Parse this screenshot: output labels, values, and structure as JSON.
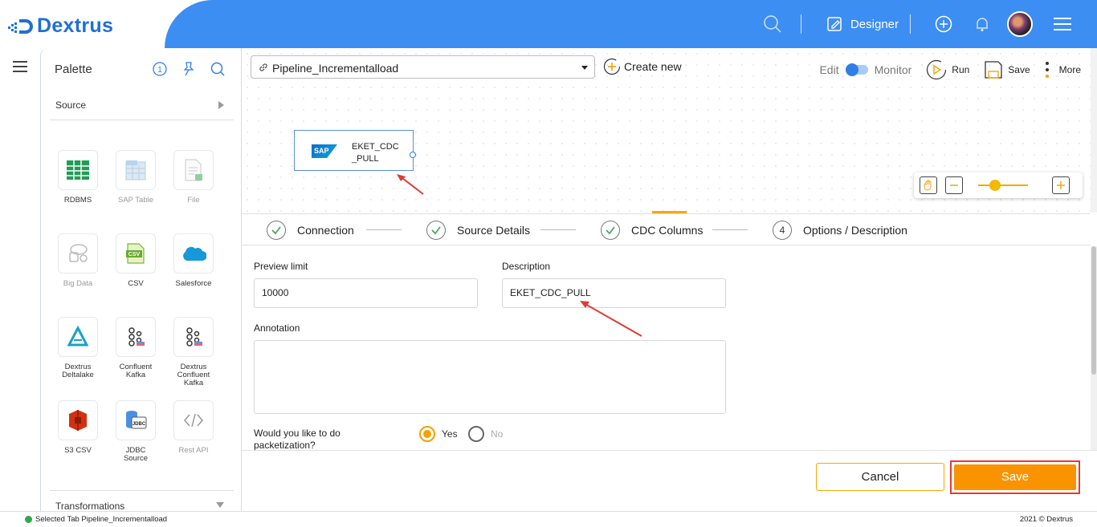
{
  "app": {
    "brand": "Dextrus",
    "accent": "#3d8ef2",
    "brand_color": "#1f6fd6"
  },
  "topbar": {
    "mode_label": "Designer",
    "icons": [
      "search-icon",
      "edit-icon",
      "add-circle-icon",
      "bell-icon",
      "avatar",
      "menu-icon"
    ]
  },
  "palette": {
    "title": "Palette",
    "header_icons": [
      "history-icon",
      "pin-icon",
      "search-icon"
    ],
    "source_section": "Source",
    "tiles": [
      {
        "label": "RDBMS",
        "icon": "table-grid-icon",
        "enabled": true
      },
      {
        "label": "SAP Table",
        "icon": "sap-table-icon",
        "enabled": false
      },
      {
        "label": "File",
        "icon": "file-icon",
        "enabled": false
      },
      {
        "label": "Big Data",
        "icon": "big-data-icon",
        "enabled": false
      },
      {
        "label": "CSV",
        "icon": "csv-icon",
        "enabled": true
      },
      {
        "label": "Salesforce",
        "icon": "salesforce-cloud-icon",
        "enabled": true
      },
      {
        "label": "Dextrus Deltalake",
        "icon": "deltalake-icon",
        "enabled": true
      },
      {
        "label": "Confluent Kafka",
        "icon": "kafka-icon",
        "enabled": true
      },
      {
        "label": "Dextrus Confluent Kafka",
        "icon": "kafka-icon",
        "enabled": true
      },
      {
        "label": "S3 CSV",
        "icon": "s3-icon",
        "enabled": true
      },
      {
        "label": "JDBC Source",
        "icon": "jdbc-icon",
        "enabled": true
      },
      {
        "label": "Rest API",
        "icon": "code-brackets-icon",
        "enabled": false
      }
    ],
    "transformations_section": "Transformations"
  },
  "canvas": {
    "pipeline_name": "Pipeline_Incrementalload",
    "create_new": "Create new",
    "edit_label": "Edit",
    "monitor_label": "Monitor",
    "run_label": "Run",
    "save_label": "Save",
    "more_label": "More",
    "node": {
      "label_line1": "EKET_CDC",
      "label_line2": "_PULL",
      "logo_text": "SAP"
    },
    "zoom_level": 0.3
  },
  "steps": [
    {
      "label": "Connection",
      "status": "done"
    },
    {
      "label": "Source Details",
      "status": "done"
    },
    {
      "label": "CDC Columns",
      "status": "done"
    },
    {
      "number": "4",
      "label": "Options / Description",
      "status": "pending"
    }
  ],
  "form": {
    "preview_limit_label": "Preview limit",
    "preview_limit_value": "10000",
    "description_label": "Description",
    "description_value": "EKET_CDC_PULL",
    "annotation_label": "Annotation",
    "annotation_value": "",
    "packetization_line1": "Would you like to do",
    "packetization_line2": "packetization?",
    "yes_label": "Yes",
    "no_label": "No",
    "packetization_selected": "Yes"
  },
  "actions": {
    "cancel": "Cancel",
    "save": "Save",
    "save_color": "#f99400"
  },
  "status": {
    "text": "Selected Tab Pipeline_Incrementalload",
    "copyright": "2021 © Dextrus"
  }
}
